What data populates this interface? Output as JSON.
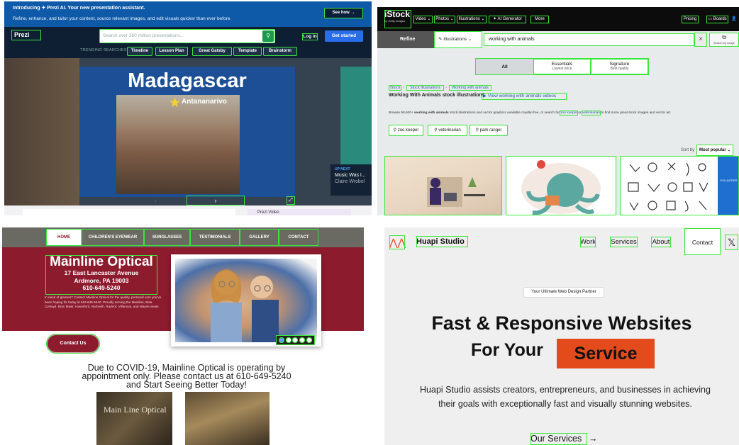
{
  "prezi": {
    "promo_title": "Introducing ✦ Prezi AI. Your new presentation assistant.",
    "promo_text": "Refine, enhance, and tailor your content, source relevant images, and edit visuals quicker than ever before.",
    "show_how": "See how →",
    "logo": "Prezi",
    "search_placeholder": "Search over 360 million presentations...",
    "login": "Log in",
    "get_started": "Get started",
    "trending_label": "TRENDING SEARCHES",
    "chips": [
      "Timeline",
      "Lesson Plan",
      "Great Gatsby",
      "Template",
      "Brainstorm"
    ],
    "slide_title": "Madagascar",
    "slide_city": "Antananarivo",
    "next_arrow": "›",
    "prev_arrow": "‹",
    "expand": "⤢",
    "up_next_label": "UP NEXT",
    "up_next_title": "Music Was I...",
    "up_next_author": "Claire Wrobel",
    "bottom_label": "Prezi Video"
  },
  "istock": {
    "logo": "iStock",
    "logo_sub": "by Getty Images",
    "menu": [
      "Video",
      "Photos",
      "Illustrations",
      "AI Generator",
      "More"
    ],
    "pricing": "Pricing",
    "boards": "Boards",
    "refine": "Refine",
    "asset_type": "Illustrations",
    "query": "working with animals",
    "clear": "×",
    "search_by_image": "Search by image",
    "segments": [
      {
        "label": "All",
        "sub": ""
      },
      {
        "label": "Essentials",
        "sub": "Lowest price"
      },
      {
        "label": "Signature",
        "sub": "Best quality"
      }
    ],
    "breadcrumb": [
      "iStock",
      "Stock Illustrations",
      "Working with animals"
    ],
    "heading": "Working With Animals stock illustrations",
    "video_link": "View working with animals videos",
    "desc_prefix": "Browse 58,600+",
    "desc_bold": "working with animals",
    "desc_mid": "stock illustrations and vector graphics available royalty-free, or search for",
    "desc_link1": "zoo keeper",
    "desc_or": "or",
    "desc_link2": "veterinarian",
    "desc_suffix": "to find more great stock images and vector art.",
    "related": [
      "zoo keeper",
      "veterinarian",
      "park ranger"
    ],
    "sort_label": "Sort by",
    "sort_value": "Most popular"
  },
  "optical": {
    "nav": [
      "HOME",
      "CHILDREN'S EYEWEAR",
      "SUNGLASSES",
      "TESTIMONIALS",
      "GALLERY",
      "CONTACT"
    ],
    "name": "Mainline Optical",
    "address1": "17 East Lancaster Avenue",
    "address2": "Ardmore, PA 19003",
    "phone": "610-649-5240",
    "blurb": "In need of glasses? Contact Mainline Optical for the quality, personal care you've been hoping for today at 610-649-5240. Proudly serving the Mainline, Bala Cynwyd, Bryn Mawr, Haverford, Narberth, Radnor, Villanova, and Wayne areas.",
    "contact_button": "Contact Us",
    "covid_line1": "Due to COVID-19, Mainline Optical is operating by",
    "covid_line2": "appointment only. Please contact us at 610-649-5240",
    "covid_line3": "and Start Seeing Better Today!",
    "storefront_sign": "Main Line Optical"
  },
  "huapi": {
    "brand": "Huapi Studio",
    "nav": [
      "Work",
      "Services",
      "About"
    ],
    "contact": "Contact",
    "x_icon": "𝕏",
    "pill": "Your Ultimate Web Design Partner",
    "headline1": "Fast & Responsive Websites",
    "headline2_prefix": "For Your",
    "headline2_highlight": "Service",
    "paragraph": "Huapi Studio assists creators, entrepreneurs, and businesses in achieving their goals with exceptionally fast and visually stunning websites.",
    "cta": "Our Services",
    "cta_arrow": "→"
  }
}
